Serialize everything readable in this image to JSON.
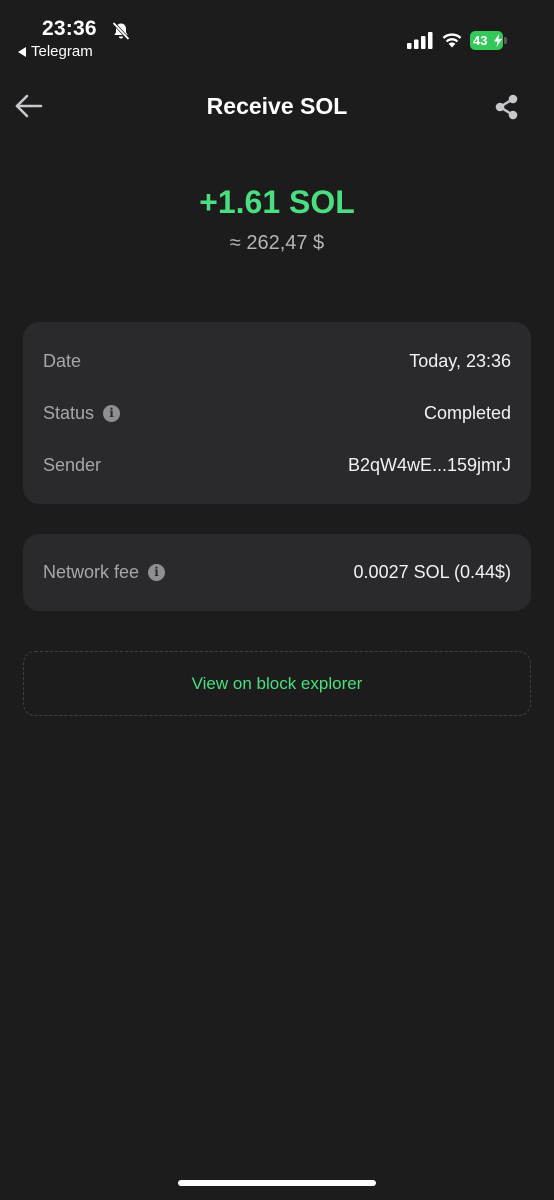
{
  "status_bar": {
    "time": "23:36",
    "back_app": "Telegram",
    "battery_level": "43",
    "icons": [
      "bell-off-icon",
      "signal-icon",
      "wifi-icon",
      "battery-icon",
      "charging-bolt-icon"
    ]
  },
  "header": {
    "title": "Receive SOL",
    "back_icon": "arrow-left-icon",
    "share_icon": "share-icon"
  },
  "amount": {
    "value": "+1.61 SOL",
    "fiat": "≈ 262,47 $"
  },
  "details": {
    "rows": [
      {
        "label": "Date",
        "value": "Today, 23:36"
      },
      {
        "label": "Status",
        "value": "Completed"
      },
      {
        "label": "Sender",
        "value": "B2qW4wE...159jmrJ"
      }
    ]
  },
  "fee": {
    "label": "Network fee",
    "value": "0.0027 SOL (0.44$)"
  },
  "explorer": {
    "label": "View on block explorer"
  },
  "colors": {
    "accent_green": "#4ade80",
    "background": "#1c1c1c",
    "card": "#2a2a2d"
  }
}
